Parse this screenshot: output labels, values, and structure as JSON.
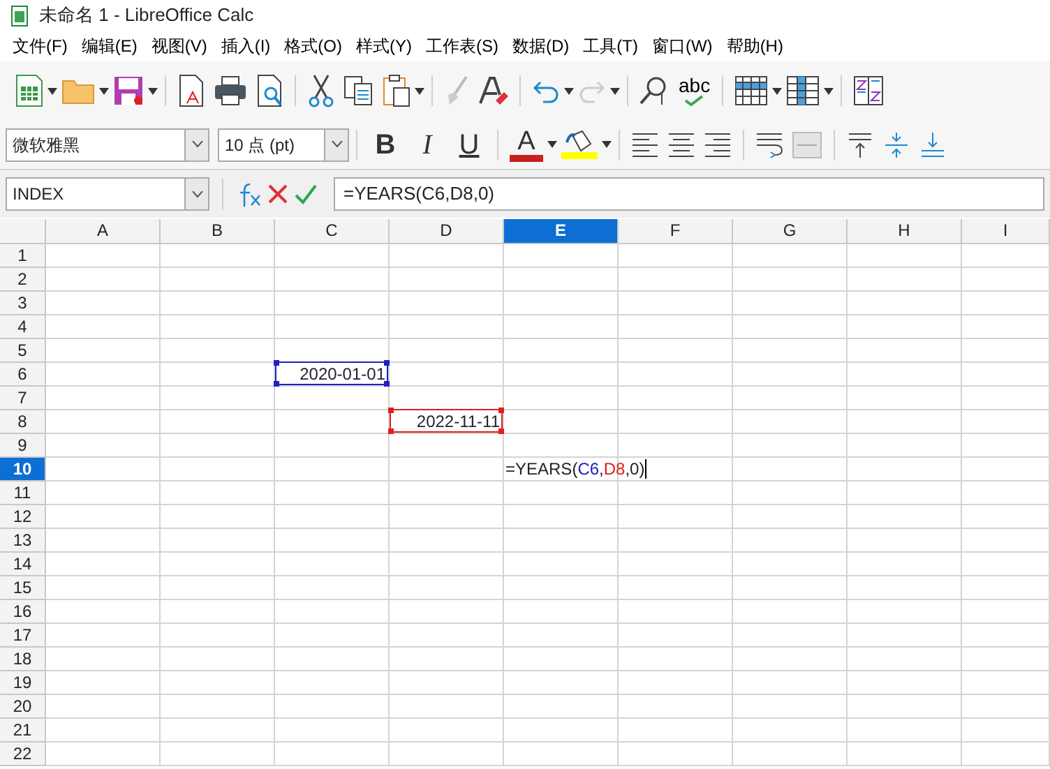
{
  "window": {
    "title": "未命名 1 - LibreOffice Calc"
  },
  "menu": [
    "文件(F)",
    "编辑(E)",
    "视图(V)",
    "插入(I)",
    "格式(O)",
    "样式(Y)",
    "工作表(S)",
    "数据(D)",
    "工具(T)",
    "窗口(W)",
    "帮助(H)"
  ],
  "toolbar": {
    "spellcheck_label": "abc"
  },
  "format_bar": {
    "font_name": "微软雅黑",
    "font_size": "10 点 (pt)",
    "bold_label": "B",
    "italic_label": "I",
    "underline_label": "U",
    "font_color_label": "A"
  },
  "formula_bar": {
    "name_box": "INDEX",
    "formula": "=YEARS(C6,D8,0)"
  },
  "columns": [
    {
      "label": "A",
      "selected": false
    },
    {
      "label": "B",
      "selected": false
    },
    {
      "label": "C",
      "selected": false
    },
    {
      "label": "D",
      "selected": false
    },
    {
      "label": "E",
      "selected": true
    },
    {
      "label": "F",
      "selected": false
    },
    {
      "label": "G",
      "selected": false
    },
    {
      "label": "H",
      "selected": false
    },
    {
      "label": "I",
      "selected": false
    }
  ],
  "rows": [
    {
      "label": "1",
      "selected": false
    },
    {
      "label": "2",
      "selected": false
    },
    {
      "label": "3",
      "selected": false
    },
    {
      "label": "4",
      "selected": false
    },
    {
      "label": "5",
      "selected": false
    },
    {
      "label": "6",
      "selected": false,
      "cells": [
        null,
        null,
        {
          "kind": "value",
          "text": "2020-01-01",
          "color": "#2020c0"
        }
      ]
    },
    {
      "label": "7",
      "selected": false
    },
    {
      "label": "8",
      "selected": false,
      "cells": [
        null,
        null,
        null,
        {
          "kind": "value",
          "text": "2022-11-11",
          "color": "#e02020"
        }
      ]
    },
    {
      "label": "9",
      "selected": false
    },
    {
      "label": "10",
      "selected": true,
      "cells": [
        null,
        null,
        null,
        null,
        {
          "kind": "editing",
          "parts": [
            {
              "text": "=YEARS("
            },
            {
              "text": "C6",
              "color": "#2020c0"
            },
            {
              "text": ","
            },
            {
              "text": "D8",
              "color": "#e02020"
            },
            {
              "text": ",0)"
            }
          ]
        }
      ]
    },
    {
      "label": "11",
      "selected": false
    },
    {
      "label": "12",
      "selected": false
    },
    {
      "label": "13",
      "selected": false
    },
    {
      "label": "14",
      "selected": false
    },
    {
      "label": "15",
      "selected": false
    },
    {
      "label": "16",
      "selected": false
    },
    {
      "label": "17",
      "selected": false
    },
    {
      "label": "18",
      "selected": false
    },
    {
      "label": "19",
      "selected": false
    },
    {
      "label": "20",
      "selected": false
    },
    {
      "label": "21",
      "selected": false
    },
    {
      "label": "22",
      "selected": false
    }
  ]
}
